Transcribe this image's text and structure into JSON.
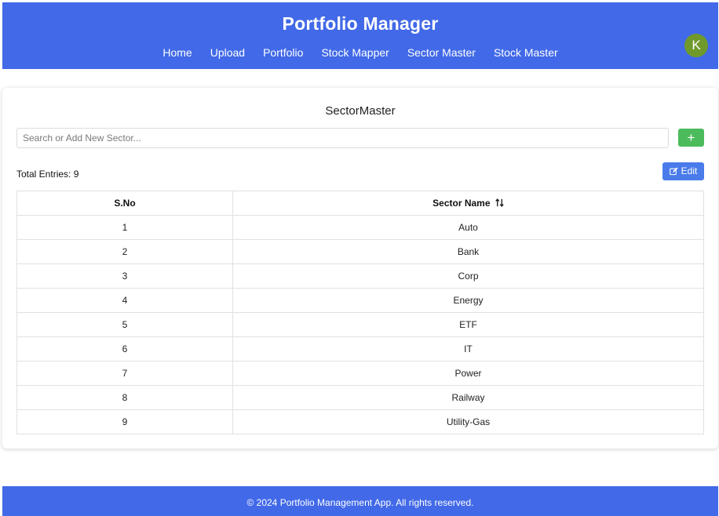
{
  "app": {
    "title": "Portfolio Manager",
    "accent_color": "#4169e8",
    "avatar_initial": "K",
    "avatar_color": "#6f9a2b"
  },
  "nav": {
    "items": [
      {
        "label": "Home"
      },
      {
        "label": "Upload"
      },
      {
        "label": "Portfolio"
      },
      {
        "label": "Stock Mapper"
      },
      {
        "label": "Sector Master"
      },
      {
        "label": "Stock Master"
      }
    ]
  },
  "sector_master": {
    "title": "SectorMaster",
    "search_placeholder": "Search or Add New Sector...",
    "search_value": "",
    "add_button_label": "+",
    "add_button_color": "#4cbb5c",
    "total_entries_label": "Total Entries: 9",
    "edit_button_label": "Edit",
    "edit_button_icon": "edit-icon",
    "table": {
      "columns": [
        "S.No",
        "Sector Name"
      ],
      "sort_icon": "sort-icon",
      "rows": [
        {
          "sno": "1",
          "name": "Auto"
        },
        {
          "sno": "2",
          "name": "Bank"
        },
        {
          "sno": "3",
          "name": "Corp"
        },
        {
          "sno": "4",
          "name": "Energy"
        },
        {
          "sno": "5",
          "name": "ETF"
        },
        {
          "sno": "6",
          "name": "IT"
        },
        {
          "sno": "7",
          "name": "Power"
        },
        {
          "sno": "8",
          "name": "Railway"
        },
        {
          "sno": "9",
          "name": "Utility-Gas"
        }
      ]
    }
  },
  "footer": {
    "text": "© 2024 Portfolio Management App. All rights reserved."
  }
}
